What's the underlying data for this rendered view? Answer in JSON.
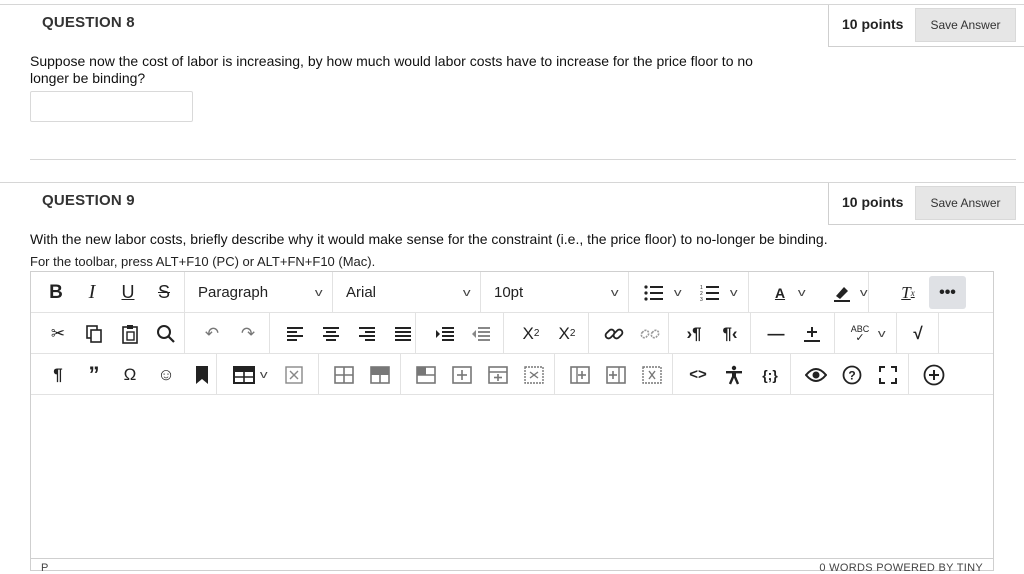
{
  "q8": {
    "title": "QUESTION 8",
    "points": "10 points",
    "save_label": "Save Answer",
    "text_line1": "Suppose now the cost of labor is increasing, by how much would labor costs have to increase for the price floor to no",
    "text_line2": "longer be binding?",
    "answer_value": ""
  },
  "q9": {
    "title": "QUESTION 9",
    "points": "10 points",
    "save_label": "Save Answer",
    "text": "With the new labor costs, briefly describe why it would make sense for the constraint (i.e., the price floor) to no-longer be binding.",
    "toolbar_hint": "For the toolbar, press ALT+F10 (PC) or ALT+FN+F10 (Mac)."
  },
  "toolbar": {
    "block_format": "Paragraph",
    "font_family": "Arial",
    "font_size": "10pt",
    "spellcheck_label": "ABC",
    "more_label": "•••"
  },
  "status": {
    "path": "P",
    "words": "0 WORDS",
    "powered": "POWERED BY TINY"
  }
}
